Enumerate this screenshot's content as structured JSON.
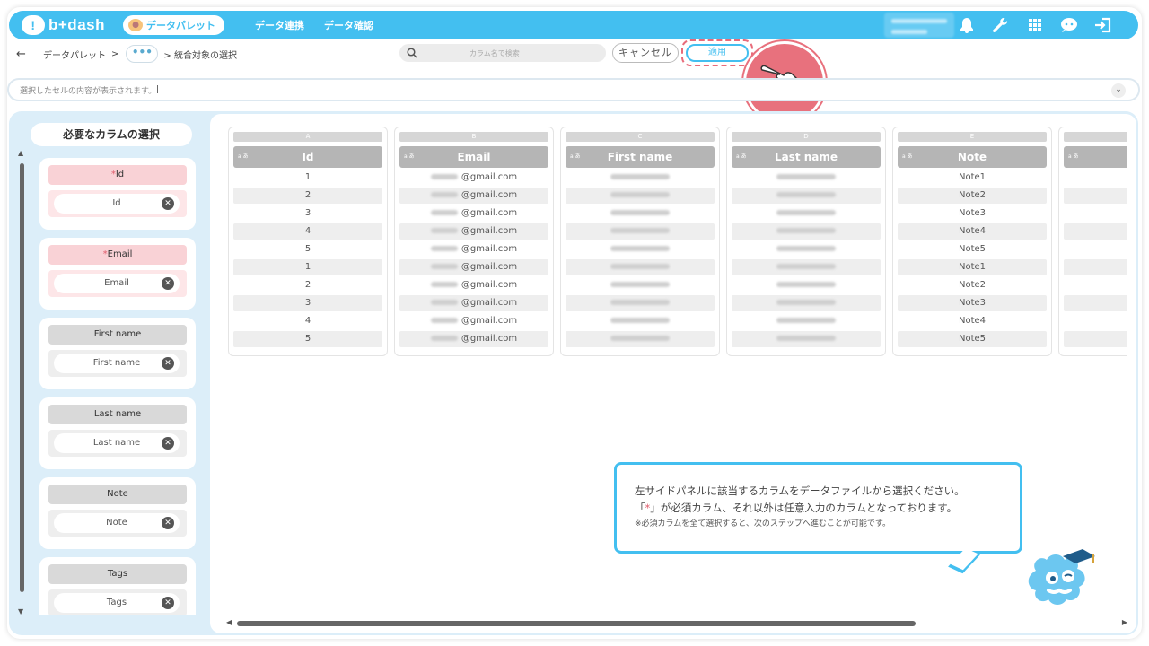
{
  "header": {
    "logo": "b+dash",
    "palette_pill": "データパレット",
    "nav": [
      "データ連携",
      "データ確認"
    ]
  },
  "toolbar": {
    "back": "←",
    "crumb1": "データパレット",
    "sep": ">",
    "dots": "•••",
    "crumb2": "> 統合対象の選択",
    "search_placeholder": "カラム名で検索",
    "cancel": "キャンセル",
    "apply": "適用"
  },
  "cellbar": {
    "text": "選択したセルの内容が表示されます。"
  },
  "sidebar": {
    "title": "必要なカラムの選択",
    "cards": [
      {
        "label": "Id",
        "required": true,
        "value": "Id"
      },
      {
        "label": "Email",
        "required": true,
        "value": "Email"
      },
      {
        "label": "First name",
        "required": false,
        "value": "First name"
      },
      {
        "label": "Last name",
        "required": false,
        "value": "Last name"
      },
      {
        "label": "Note",
        "required": false,
        "value": "Note"
      },
      {
        "label": "Tags",
        "required": false,
        "value": "Tags"
      }
    ]
  },
  "table": {
    "type_tag": "a あ",
    "columns": [
      {
        "letter": "A",
        "name": "Id",
        "values": [
          "1",
          "2",
          "3",
          "4",
          "5",
          "1",
          "2",
          "3",
          "4",
          "5"
        ]
      },
      {
        "letter": "B",
        "name": "Email",
        "values": [
          "@gmail.com",
          "@gmail.com",
          "@gmail.com",
          "@gmail.com",
          "@gmail.com",
          "@gmail.com",
          "@gmail.com",
          "@gmail.com",
          "@gmail.com",
          "@gmail.com"
        ]
      },
      {
        "letter": "C",
        "name": "First name",
        "values": [
          "",
          "",
          "",
          "",
          "",
          "",
          "",
          "",
          "",
          ""
        ]
      },
      {
        "letter": "D",
        "name": "Last name",
        "values": [
          "",
          "",
          "",
          "",
          "",
          "",
          "",
          "",
          "",
          ""
        ]
      },
      {
        "letter": "E",
        "name": "Note",
        "values": [
          "Note1",
          "Note2",
          "Note3",
          "Note4",
          "Note5",
          "Note1",
          "Note2",
          "Note3",
          "Note4",
          "Note5"
        ]
      },
      {
        "letter": "",
        "name": "",
        "values": [
          "",
          "",
          "",
          "",
          "",
          "",
          "",
          "",
          "",
          ""
        ]
      }
    ]
  },
  "tooltip": {
    "line1": "左サイドパネルに該当するカラムをデータファイルから選択ください。",
    "line2_pre": "「",
    "line2_star": "*",
    "line2_post": "」が必須カラム、それ以外は任意入力のカラムとなっております。",
    "line3": "※必須カラムを全て選択すると、次のステップへ進むことが可能です。"
  },
  "colors": {
    "accent": "#43bff0",
    "required": "#e05c6c",
    "highlight": "#e8717d"
  },
  "icons": [
    "bell-icon",
    "wrench-icon",
    "grid-icon",
    "chat-icon",
    "logout-icon",
    "search-icon",
    "pointing-hand-icon",
    "close-icon"
  ]
}
